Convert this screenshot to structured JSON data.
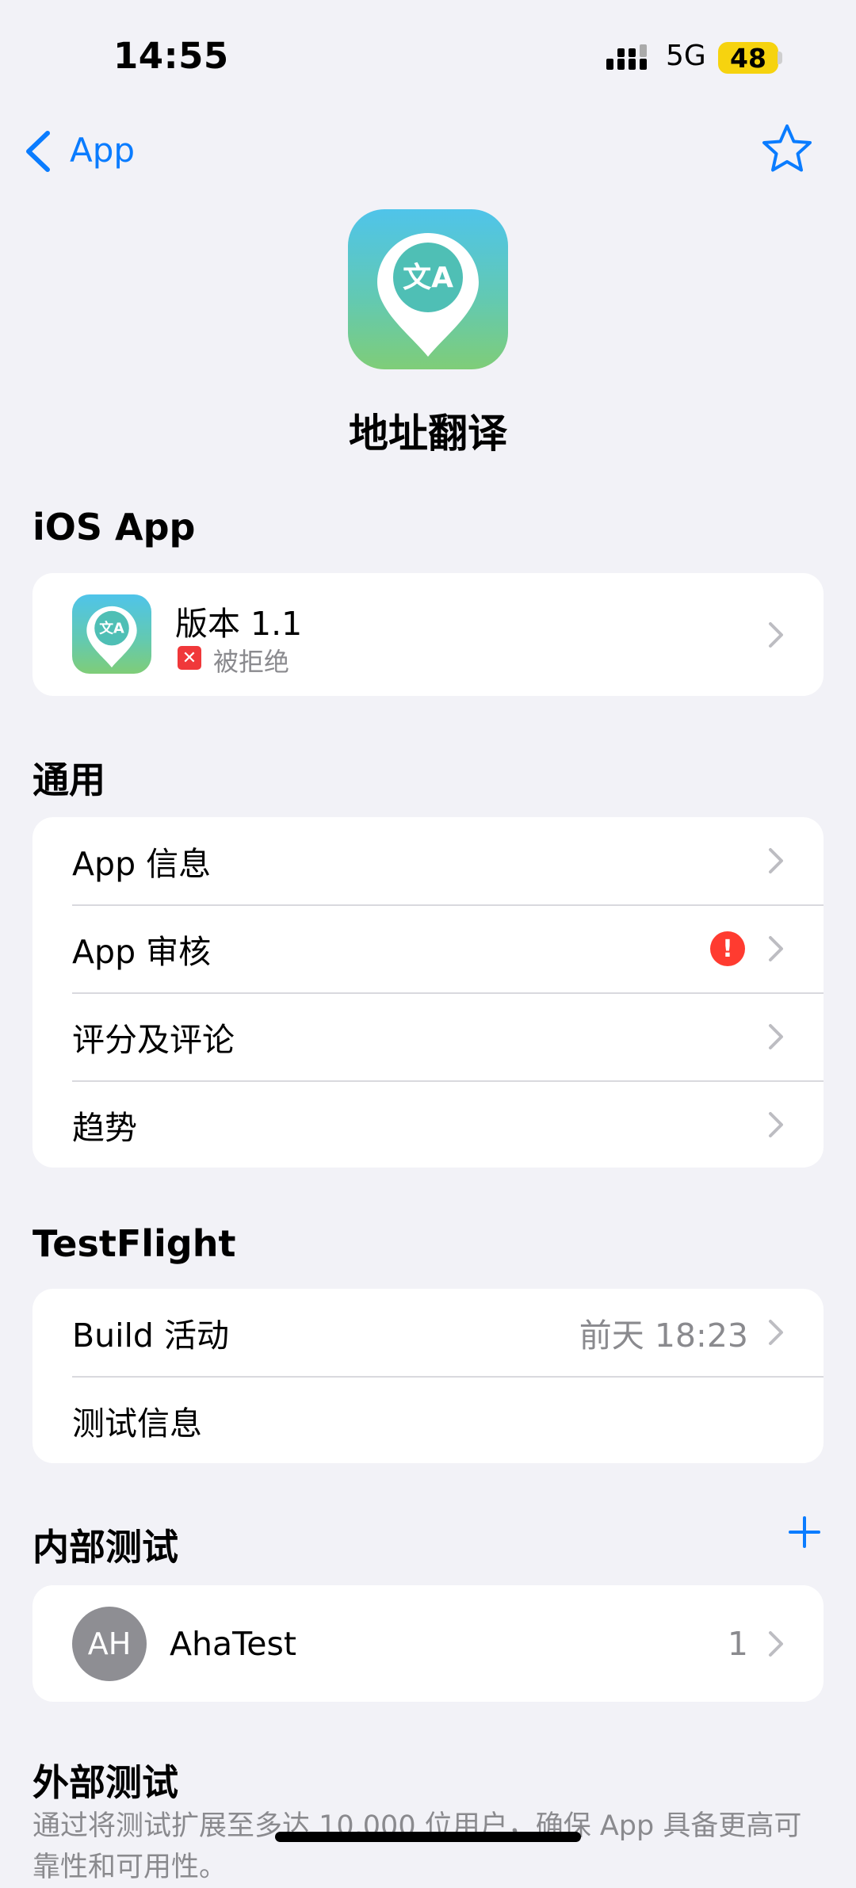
{
  "status_bar": {
    "time": "14:55",
    "network": "5G",
    "battery": "48"
  },
  "nav": {
    "back_label": "App"
  },
  "app": {
    "name": "地址翻译",
    "icon_glyph": "文A"
  },
  "ios_app_section": {
    "header": "iOS App",
    "version_label": "版本 1.1",
    "status_label": "被拒绝",
    "status_icon": "✕"
  },
  "general_section": {
    "header": "通用",
    "items": [
      {
        "label": "App 信息"
      },
      {
        "label": "App 审核",
        "badge": "!"
      },
      {
        "label": "评分及评论"
      },
      {
        "label": "趋势"
      }
    ]
  },
  "testflight_section": {
    "header": "TestFlight",
    "build_label": "Build 活动",
    "build_value": "前天 18:23",
    "test_info_label": "测试信息"
  },
  "internal_section": {
    "header": "内部测试",
    "group_initials": "AH",
    "group_name": "AhaTest",
    "group_count": "1"
  },
  "external_section": {
    "header": "外部测试",
    "description": "通过将测试扩展至多达 10,000 位用户，确保 App 具备更高可靠性和可用性。"
  },
  "colors": {
    "accent": "#0a7cff",
    "background": "#f2f2f7",
    "alert": "#ff3b30",
    "battery": "#f6d30f"
  },
  "icons": [
    "signal-icon",
    "battery-icon",
    "back-chevron-icon",
    "star-icon",
    "chevron-right-icon",
    "plus-icon",
    "alert-icon",
    "rejected-icon",
    "translate-pin-icon"
  ]
}
